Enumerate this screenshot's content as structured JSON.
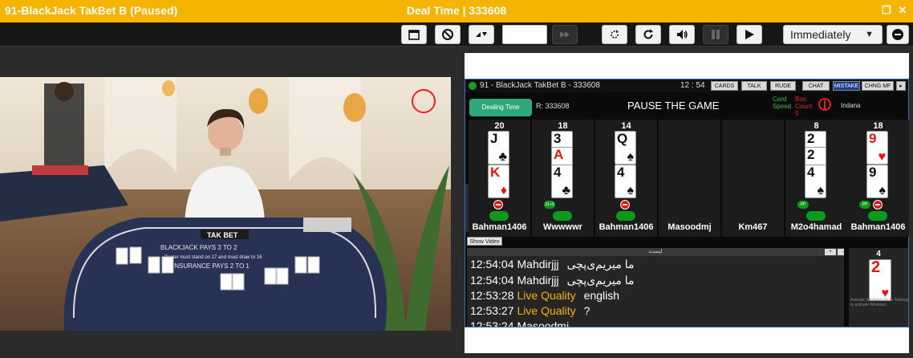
{
  "window": {
    "title": "91-BlackJack TakBet B (Paused)",
    "center_status": "Deal Time | 333608",
    "controls": [
      "restore-icon",
      "close-icon"
    ]
  },
  "toolbar": {
    "buttons": [
      "calendar-icon",
      "block-icon",
      "sort-icon",
      "speed-input",
      "fast-forward-icon",
      "refresh-icon",
      "rotate-icon",
      "volume-icon",
      "pause-icon",
      "play-icon"
    ],
    "deal_mode": "Immediately",
    "remove_icon": "minus-circle-icon"
  },
  "video": {
    "table_text": "BLACKJACK PAYS 3 TO 2",
    "table_subtext": "Dealer must stand on 17 and must draw to 16",
    "insurance": "INSURANCE PAYS 2 TO 1",
    "brand": "TAK BET"
  },
  "game": {
    "header_title": "91 - BlackJack TakBet B - 333608",
    "header_time": "12 : 54",
    "header_buttons": [
      {
        "label": "CARDS",
        "active": false
      },
      {
        "label": "TALK",
        "active": false
      },
      {
        "label": "RUDE",
        "active": false
      },
      {
        "label": "CHAT",
        "active": false
      },
      {
        "label": "MISTAKE",
        "active": true
      },
      {
        "label": "CHNG MF",
        "active": false
      }
    ],
    "dealing_label": "Dealing Time",
    "round": "R: 333608",
    "pause_text": "PAUSE THE GAME",
    "card_speed": "Card\nSpeed",
    "box_count": "Box\nCount\n5",
    "dealer_name": "Indana",
    "show_video": "Show Video",
    "seats": [
      {
        "total": "20",
        "player": "Bahman1406",
        "cards": [
          {
            "rank": "J",
            "suit": "♣",
            "color": "black"
          },
          {
            "rank": "K",
            "suit": "♦",
            "color": "red"
          }
        ],
        "status": "minus-icon"
      },
      {
        "total": "18",
        "player": "Wwwwwr",
        "cards": [
          {
            "rank": "3",
            "suit": "♣",
            "color": "black"
          },
          {
            "rank": "A",
            "suit": "♥",
            "color": "red"
          },
          {
            "rank": "4",
            "suit": "♣",
            "color": "black"
          }
        ],
        "status": "21+3"
      },
      {
        "total": "14",
        "player": "Bahman1406",
        "cards": [
          {
            "rank": "Q",
            "suit": "♠",
            "color": "black"
          },
          {
            "rank": "4",
            "suit": "♠",
            "color": "black"
          }
        ],
        "status": "minus-icon"
      },
      {
        "total": "",
        "player": "Masoodmj",
        "cards": [],
        "status": ""
      },
      {
        "total": "",
        "player": "Km467",
        "cards": [],
        "status": ""
      },
      {
        "total": "8",
        "player": "M2o4hamad",
        "cards": [
          {
            "rank": "2",
            "suit": "♠",
            "color": "black"
          },
          {
            "rank": "2",
            "suit": "♠",
            "color": "black"
          },
          {
            "rank": "4",
            "suit": "♠",
            "color": "black"
          }
        ],
        "status": "PP"
      },
      {
        "total": "18",
        "player": "Bahman1406",
        "cards": [
          {
            "rank": "9",
            "suit": "♥",
            "color": "red"
          },
          {
            "rank": "9",
            "suit": "♠",
            "color": "black"
          }
        ],
        "status": "PP"
      }
    ],
    "chat": {
      "header": "لیست",
      "messages": [
        {
          "time": "12:54:04",
          "name": "Mahdirjjj",
          "text": "ما میریم‌ی‌پچی",
          "highlight": false
        },
        {
          "time": "12:54:04",
          "name": "Mahdirjjj",
          "text": "ما میریم‌ی‌پچی",
          "highlight": false
        },
        {
          "time": "12:53:28",
          "name": "Live Quality",
          "text": "english",
          "highlight": true
        },
        {
          "time": "12:53:27",
          "name": "Live Quality",
          "text": "?",
          "highlight": true
        },
        {
          "time": "12:53:24",
          "name": "Masoodmj",
          "text": "",
          "highlight": false
        }
      ]
    },
    "mini_card": {
      "total": "4",
      "rank": "2",
      "suit": "♥",
      "watermark": "Activate Windows Go to Settings to activate Windows."
    }
  }
}
